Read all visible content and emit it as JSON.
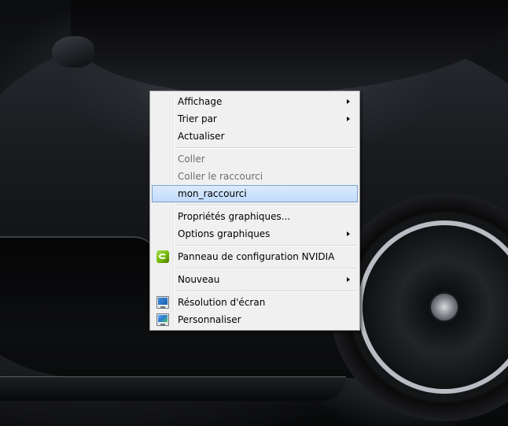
{
  "desktop": {
    "wallpaper": "dark sports car"
  },
  "context_menu": {
    "items": [
      {
        "label": "Affichage",
        "has_submenu": true,
        "disabled": false
      },
      {
        "label": "Trier par",
        "has_submenu": true,
        "disabled": false
      },
      {
        "label": "Actualiser",
        "has_submenu": false,
        "disabled": false
      },
      {
        "label": "Coller",
        "has_submenu": false,
        "disabled": true
      },
      {
        "label": "Coller le raccourci",
        "has_submenu": false,
        "disabled": true
      },
      {
        "label": "mon_raccourci",
        "has_submenu": false,
        "disabled": false,
        "highlighted": true
      },
      {
        "label": "Propriétés graphiques...",
        "has_submenu": false,
        "disabled": false
      },
      {
        "label": "Options graphiques",
        "has_submenu": true,
        "disabled": false
      },
      {
        "label": "Panneau de configuration NVIDIA",
        "has_submenu": false,
        "disabled": false,
        "icon": "nvidia-icon"
      },
      {
        "label": "Nouveau",
        "has_submenu": true,
        "disabled": false
      },
      {
        "label": "Résolution d'écran",
        "has_submenu": false,
        "disabled": false,
        "icon": "screen-resolution-icon"
      },
      {
        "label": "Personnaliser",
        "has_submenu": false,
        "disabled": false,
        "icon": "personalize-icon"
      }
    ]
  },
  "colors": {
    "menu_background": "#f0f0f0",
    "highlight": "#c1dbfc",
    "highlight_border": "#7da2ce",
    "disabled_text": "#6d6d6d",
    "nvidia_green": "#76b900"
  }
}
